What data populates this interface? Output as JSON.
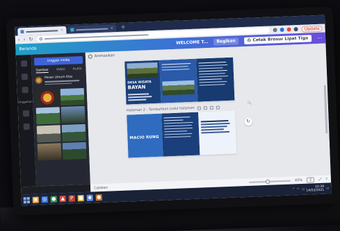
{
  "browser": {
    "tabs": [
      {
        "fav_color": "#4f7bd9"
      },
      {
        "fav_color": "#2fb3c9"
      }
    ],
    "update_button": "Update",
    "ext_colors": [
      "#6c757d",
      "#2d6cdf",
      "#e04b3a",
      "#444a58"
    ]
  },
  "editor": {
    "toolbar": {
      "home": "Beranda",
      "title": "WELCOME T...",
      "share": "Bagikan",
      "print": "Cetak Brosur Lipat Tiga",
      "gradient": [
        "#1f9fc5",
        "#3f6ed6",
        "#6a4fd8"
      ]
    },
    "rail": {
      "label": "Unggahan"
    },
    "panel": {
      "upload_button": "Unggah media",
      "tabs": [
        "Gambar",
        "Video",
        "Audio"
      ],
      "folder_name": "Pesan Umum Klas"
    },
    "canvas": {
      "animate_label": "Animasikan",
      "page1": {
        "heading_lines": [
          "DESA WISATA",
          "BAYAN"
        ]
      },
      "page2": {
        "header": "Halaman 2 - Tambahkan judul halaman",
        "heading": "MACIO RUNG"
      }
    },
    "bottom": {
      "notes": "Catatan",
      "zoom": "45%",
      "zoom_level": 0.45,
      "page_count": "2"
    }
  },
  "taskbar": {
    "apps": [
      {
        "color": "#e8a33a",
        "glyph": "▣"
      },
      {
        "color": "#3a7be0",
        "glyph": "◎"
      },
      {
        "color": "#3d9b4f",
        "glyph": "●"
      },
      {
        "color": "#d34a3a",
        "glyph": "▲"
      },
      {
        "color": "#c7442f",
        "glyph": "P"
      },
      {
        "color": "#e2b23a",
        "glyph": "■"
      },
      {
        "color": "#5a8de6",
        "glyph": "◆"
      },
      {
        "color": "#d9731f",
        "glyph": "●"
      }
    ],
    "time": "22:39",
    "date": "14/03/2021"
  }
}
